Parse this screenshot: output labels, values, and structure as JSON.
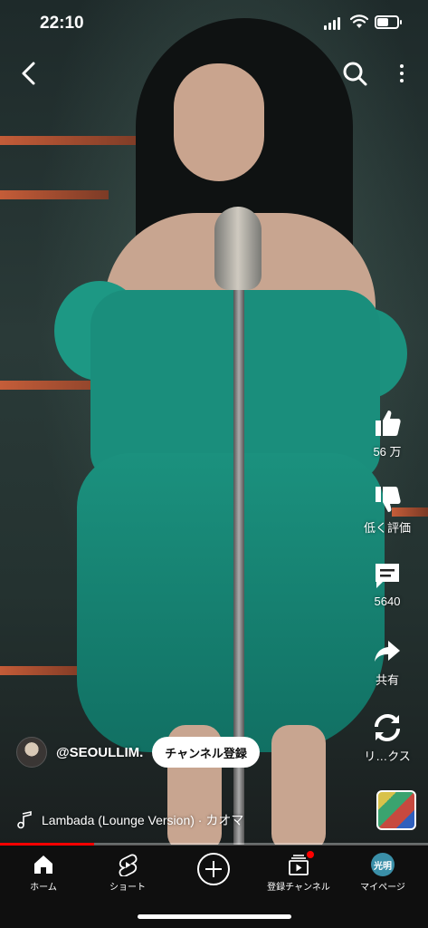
{
  "status_bar": {
    "time": "22:10",
    "battery_level": 0.55
  },
  "top_bar": {
    "back_icon": "chevron-left-icon",
    "search_icon": "search-icon",
    "more_icon": "more-vertical-icon"
  },
  "actions": {
    "like": {
      "label": "56 万",
      "icon": "thumbs-up-icon"
    },
    "dislike": {
      "label": "低く評価",
      "icon": "thumbs-down-icon"
    },
    "comments": {
      "label": "5640",
      "icon": "comment-icon"
    },
    "share": {
      "label": "共有",
      "icon": "share-icon"
    },
    "remix": {
      "label": "リ…クス",
      "icon": "remix-icon"
    }
  },
  "channel": {
    "name": "@SEOULLIM.",
    "subscribe_label": "チャンネル登録"
  },
  "music": {
    "title": "Lambada (Lounge Version) · カオマ",
    "icon": "music-note-icon"
  },
  "progress": 0.22,
  "colors": {
    "accent": "#ff0000",
    "nav_bg": "#0f0f0f",
    "subscribe_bg": "#ffffff"
  },
  "nav": {
    "home": "ホーム",
    "shorts": "ショート",
    "subscriptions": "登録チャンネル",
    "me": "マイページ",
    "me_avatar_text": "光明"
  }
}
